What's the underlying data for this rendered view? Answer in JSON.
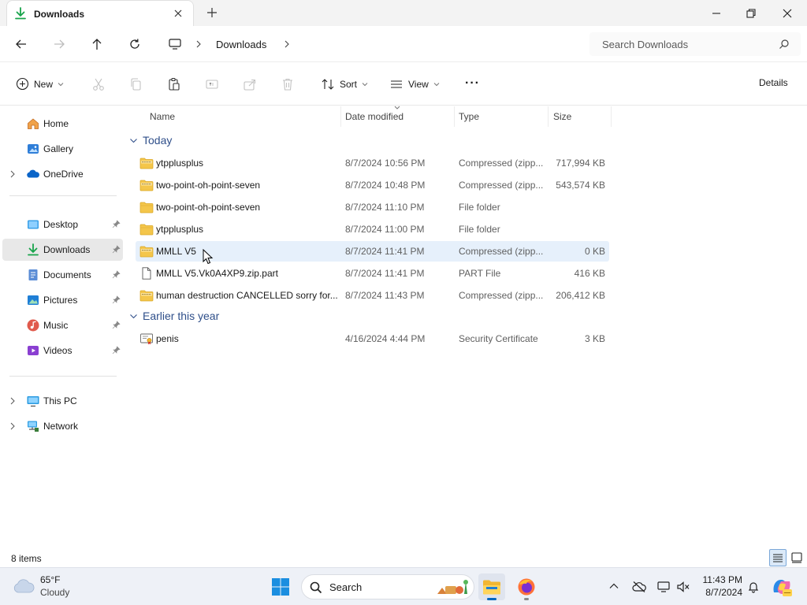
{
  "window": {
    "tab_title": "Downloads",
    "new_tab_symbol": "+"
  },
  "address": {
    "breadcrumb": [
      "Downloads"
    ],
    "search_placeholder": "Search Downloads"
  },
  "toolbar": {
    "new_label": "New",
    "sort_label": "Sort",
    "view_label": "View",
    "more_label": "···",
    "details_label": "Details"
  },
  "sidebar": {
    "items": [
      {
        "label": "Home",
        "icon": "home-icon"
      },
      {
        "label": "Gallery",
        "icon": "gallery-icon"
      },
      {
        "label": "OneDrive",
        "icon": "onedrive-icon"
      },
      {
        "label": "Desktop",
        "icon": "desktop-icon",
        "pinned": true
      },
      {
        "label": "Downloads",
        "icon": "downloads-icon",
        "pinned": true,
        "selected": true
      },
      {
        "label": "Documents",
        "icon": "documents-icon",
        "pinned": true
      },
      {
        "label": "Pictures",
        "icon": "pictures-icon",
        "pinned": true
      },
      {
        "label": "Music",
        "icon": "music-icon",
        "pinned": true
      },
      {
        "label": "Videos",
        "icon": "videos-icon",
        "pinned": true
      },
      {
        "label": "This PC",
        "icon": "this-pc-icon"
      },
      {
        "label": "Network",
        "icon": "network-icon"
      }
    ]
  },
  "columns": {
    "name": "Name",
    "date": "Date modified",
    "type": "Type",
    "size": "Size"
  },
  "groups": {
    "today": "Today",
    "earlier": "Earlier this year"
  },
  "files": [
    {
      "name": "ytpplusplus",
      "date": "8/7/2024 10:56 PM",
      "type": "Compressed (zipp...",
      "size": "717,994 KB",
      "icon": "zip-folder-icon"
    },
    {
      "name": "two-point-oh-point-seven",
      "date": "8/7/2024 10:48 PM",
      "type": "Compressed (zipp...",
      "size": "543,574 KB",
      "icon": "zip-folder-icon"
    },
    {
      "name": "two-point-oh-point-seven",
      "date": "8/7/2024 11:10 PM",
      "type": "File folder",
      "size": "",
      "icon": "folder-icon"
    },
    {
      "name": "ytpplusplus",
      "date": "8/7/2024 11:00 PM",
      "type": "File folder",
      "size": "",
      "icon": "folder-icon"
    },
    {
      "name": "MMLL V5",
      "date": "8/7/2024 11:41 PM",
      "type": "Compressed (zipp...",
      "size": "0 KB",
      "icon": "zip-folder-icon"
    },
    {
      "name": "MMLL V5.Vk0A4XP9.zip.part",
      "date": "8/7/2024 11:41 PM",
      "type": "PART File",
      "size": "416 KB",
      "icon": "file-icon"
    },
    {
      "name": "human destruction CANCELLED sorry for...",
      "date": "8/7/2024 11:43 PM",
      "type": "Compressed (zipp...",
      "size": "206,412 KB",
      "icon": "zip-folder-icon"
    },
    {
      "name": "penis",
      "date": "4/16/2024 4:44 PM",
      "type": "Security Certificate",
      "size": "3 KB",
      "icon": "certificate-icon"
    }
  ],
  "status": {
    "item_count": "8 items"
  },
  "taskbar": {
    "weather_temp": "65°F",
    "weather_cond": "Cloudy",
    "search_placeholder": "Search",
    "time": "11:43 PM",
    "date": "8/7/2024"
  },
  "colors": {
    "accent": "#0067c0",
    "folder": "#f4c64b",
    "selected_row": "#e6f0fb",
    "group_header": "#2f4f8a"
  }
}
